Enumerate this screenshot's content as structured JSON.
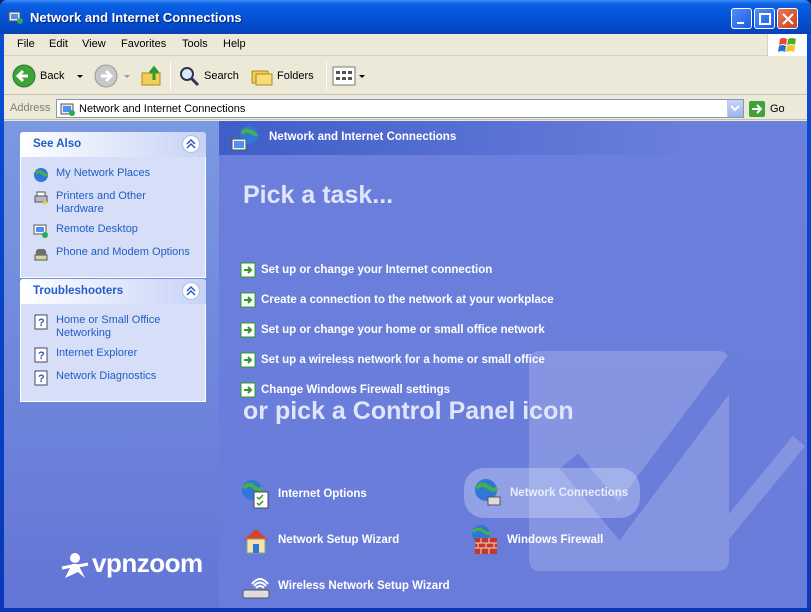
{
  "window": {
    "title": "Network and Internet Connections"
  },
  "menubar": {
    "items": [
      "File",
      "Edit",
      "View",
      "Favorites",
      "Tools",
      "Help"
    ]
  },
  "toolbar": {
    "back_label": "Back",
    "search_label": "Search",
    "folders_label": "Folders"
  },
  "address": {
    "label": "Address",
    "value": "Network and Internet Connections",
    "go_label": "Go"
  },
  "see_also": {
    "title": "See Also",
    "items": [
      {
        "label": "My Network Places",
        "icon": "network-places-icon"
      },
      {
        "label": "Printers and Other Hardware",
        "icon": "printer-icon"
      },
      {
        "label": "Remote Desktop",
        "icon": "remote-desktop-icon"
      },
      {
        "label": "Phone and Modem Options",
        "icon": "phone-icon"
      }
    ]
  },
  "troubleshooters": {
    "title": "Troubleshooters",
    "items": [
      {
        "label": "Home or Small Office Networking",
        "icon": "help-icon"
      },
      {
        "label": "Internet Explorer",
        "icon": "help-icon"
      },
      {
        "label": "Network Diagnostics",
        "icon": "help-icon"
      }
    ]
  },
  "watermark": {
    "brand_a": "vpn",
    "brand_b": "zoom"
  },
  "main": {
    "header": "Network and Internet Connections",
    "pick_task_title": "Pick a task...",
    "tasks": [
      "Set up or change your Internet connection",
      "Create a connection to the network at your workplace",
      "Set up or change your home or small office network",
      "Set up a wireless network for a home or small office",
      "Change Windows Firewall settings"
    ],
    "pick_icon_title": "or pick a Control Panel icon",
    "icons": [
      {
        "label": "Internet Options",
        "icon": "internet-options-icon"
      },
      {
        "label": "Network Connections",
        "icon": "network-connections-icon",
        "highlighted": true
      },
      {
        "label": "Network Setup Wizard",
        "icon": "network-setup-wizard-icon"
      },
      {
        "label": "Windows Firewall",
        "icon": "firewall-icon"
      },
      {
        "label": "Wireless Network Setup Wizard",
        "icon": "wireless-wizard-icon"
      }
    ]
  },
  "colors": {
    "title_bar": "#0553d6",
    "left_pane": "#7b99e1",
    "right_pane": "#6b7fdc",
    "link_blue": "#215dc6"
  }
}
